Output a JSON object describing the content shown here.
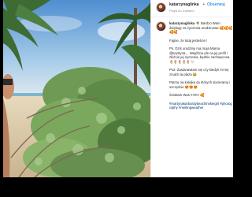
{
  "post": {
    "username": "katarzynaglinka",
    "separator": "•",
    "follow_label": "Obserwuj",
    "location": "Playa du Dabland"
  },
  "caption": {
    "author": "katarzynaglinka",
    "lines": [
      "🌴 Bardzo Wam dziękuję za życzenia urodzinowe 🥰🥰🥰🥰🥰",
      "Fajnie, że tutaj jesteście !",
      "Ps. Dziś urodziny ma moja Mama @krystyna… Wejdźcie pls na jej profil i złóżcie jej życzenia, będzie zachwycona 🌷🌷🌷🌷🌷🤍",
      "Ps2. Zastanawiam się czy kiedyś mi się znudzi ta plaża 😂",
      "Patrzę na kolejkę do których docieramy i szczęście 😍😍😍",
      "Ściskam Was !!!!!!!!! 🥰",
      "#martynakarbardybeachinskiegirl #photography #meltingweather"
    ]
  },
  "colors": {
    "link": "#3897f0",
    "hashtag": "#003569"
  }
}
